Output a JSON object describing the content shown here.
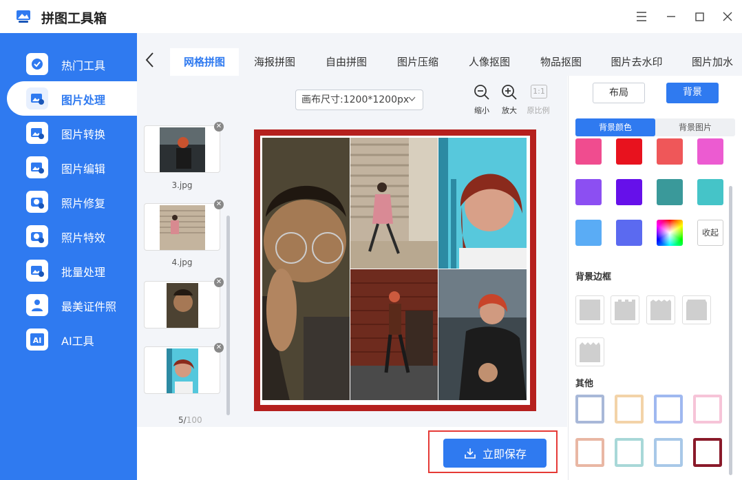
{
  "app": {
    "title": "拼图工具箱",
    "icon": "app-logo-icon"
  },
  "window": {
    "menu_icon": "menu-icon",
    "minimize_icon": "minimize-icon",
    "maximize_icon": "maximize-icon",
    "close_icon": "close-icon"
  },
  "sidebar": {
    "items": [
      {
        "label": "热门工具",
        "icon": "hot-tools-icon"
      },
      {
        "label": "图片处理",
        "icon": "image-process-icon",
        "active": true
      },
      {
        "label": "图片转换",
        "icon": "image-convert-icon"
      },
      {
        "label": "图片编辑",
        "icon": "image-edit-icon"
      },
      {
        "label": "照片修复",
        "icon": "photo-repair-icon"
      },
      {
        "label": "照片特效",
        "icon": "photo-effects-icon"
      },
      {
        "label": "批量处理",
        "icon": "batch-process-icon"
      },
      {
        "label": "最美证件照",
        "icon": "id-photo-icon"
      },
      {
        "label": "AI工具",
        "icon": "ai-tools-icon"
      }
    ]
  },
  "tabs": {
    "back_icon": "chevron-left-icon",
    "items": [
      "网格拼图",
      "海报拼图",
      "自由拼图",
      "图片压缩",
      "人像抠图",
      "物品抠图",
      "图片去水印",
      "图片加水"
    ]
  },
  "thumbnails": {
    "items": [
      {
        "name": "3.jpg"
      },
      {
        "name": "4.jpg"
      },
      {
        "name": ""
      },
      {
        "name": ""
      }
    ],
    "count_current": "5/",
    "count_max": "100"
  },
  "canvas": {
    "size_select": "画布尺寸:1200*1200px",
    "zoom_out": "缩小",
    "zoom_in": "放大",
    "ratio_box": "1:1",
    "original_ratio": "原比例",
    "border_color": "#b5201e"
  },
  "bottom": {
    "save_label": "立即保存"
  },
  "right_panel": {
    "layout_tab": "布局",
    "background_tab": "背景",
    "sub_bg_color": "背景颜色",
    "sub_bg_image": "背景图片",
    "swatches": [
      "#f04c8f",
      "#e8121e",
      "#ef5759",
      "#ec5bd1",
      "#8c4ff2",
      "#6610ea",
      "#3a999a",
      "#45c4c8",
      "#5aacf5",
      "#5b6af0"
    ],
    "collapse_label": "收起",
    "border_section": "背景边框",
    "other_section": "其他"
  },
  "colors": {
    "accent": "#2f7af0",
    "sidebar_bg": "#2f7af0",
    "highlight": "#e53935"
  }
}
